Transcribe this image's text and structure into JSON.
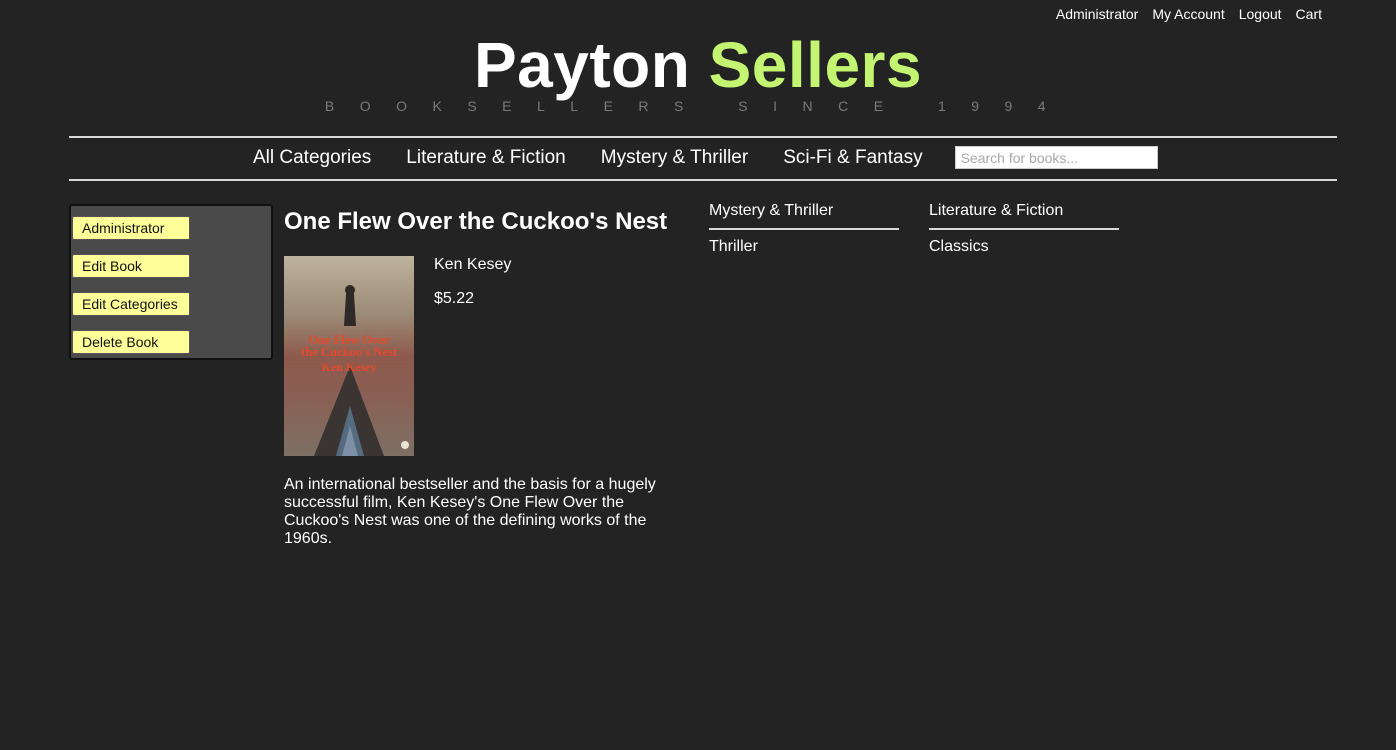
{
  "top_links": [
    "Administrator",
    "My Account",
    "Logout",
    "Cart"
  ],
  "brand": {
    "title_first": "Payton",
    "title_second": "Sellers",
    "tagline": "BOOKSELLERS SINCE 1994",
    "title_first_color": "#ffffff",
    "title_second_color": "#c3f572"
  },
  "nav": {
    "items": [
      "All Categories",
      "Literature & Fiction",
      "Mystery & Thriller",
      "Sci-Fi & Fantasy"
    ],
    "search_placeholder": "Search for books..."
  },
  "admin_panel": {
    "buttons": [
      "Administrator",
      "Edit Book",
      "Edit Categories",
      "Delete Book"
    ],
    "button_color": "#ffff99"
  },
  "book": {
    "title": "One Flew Over the Cuckoo's Nest",
    "author": "Ken Kesey",
    "price": "$5.22",
    "description": "An international bestseller and the basis for a hugely successful film, Ken Kesey's One Flew Over the Cuckoo's Nest was one of the defining works of the 1960s.",
    "cover_text": [
      "One Flew Over",
      "the Cuckoo's Nest",
      "Ken Kesey"
    ]
  },
  "categories": [
    {
      "parent": "Mystery & Thriller",
      "child": "Thriller"
    },
    {
      "parent": "Literature & Fiction",
      "child": "Classics"
    }
  ]
}
